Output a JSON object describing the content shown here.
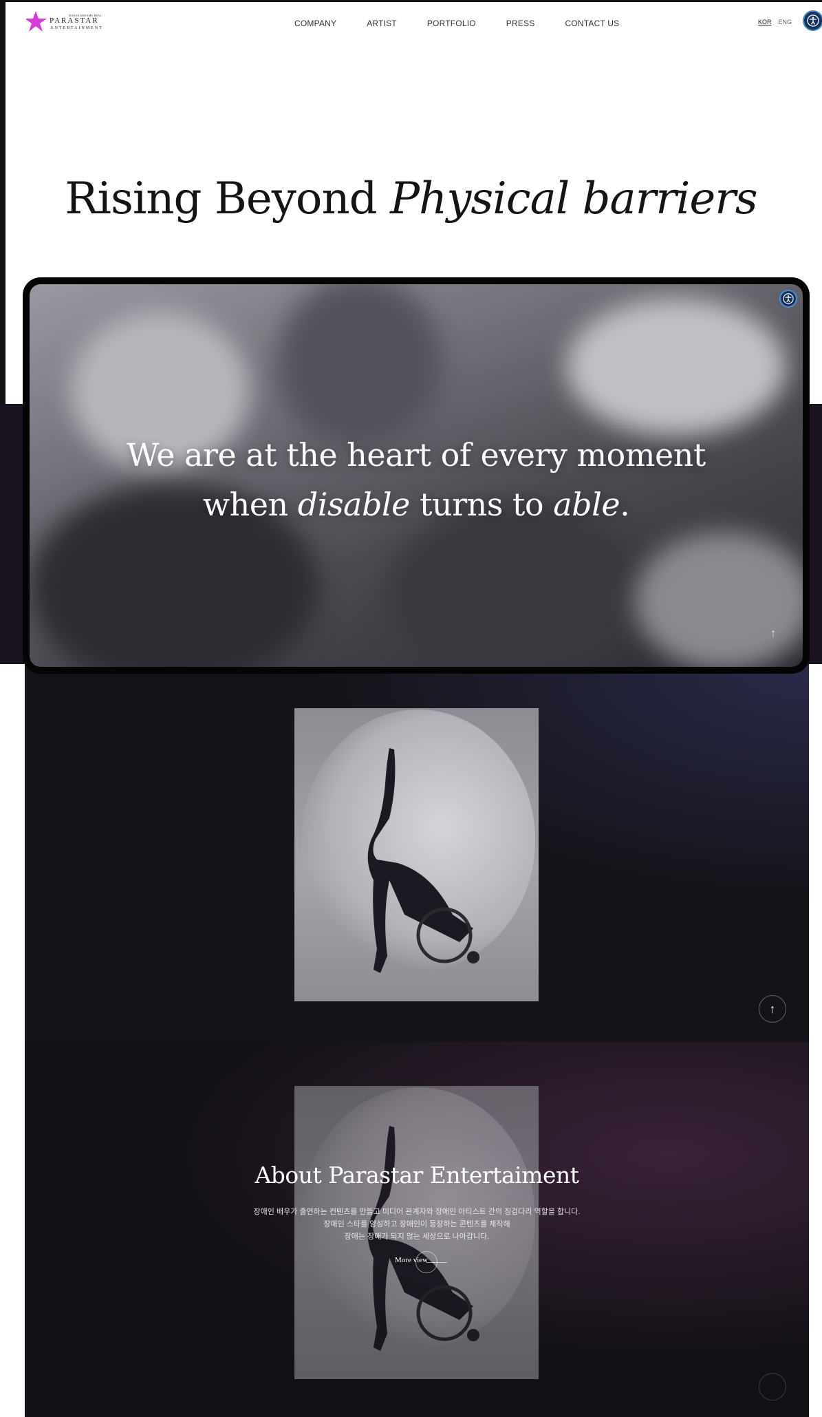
{
  "header": {
    "logo": {
      "tagline": "MAKES DREAMS REAL",
      "name": "PARASTAR",
      "sub": "ENTERTAINMENT"
    },
    "nav": [
      "COMPANY",
      "ARTIST",
      "PORTFOLIO",
      "PRESS",
      "CONTACT US"
    ],
    "lang": {
      "kor": "KOR",
      "eng": "ENG"
    },
    "accessibility_icon": "accessibility-icon"
  },
  "hero": {
    "title_plain": "Rising Beyond ",
    "title_italic": "Physical barriers"
  },
  "video": {
    "line1": "We are at the heart of every moment",
    "line2_a": "when ",
    "line2_b": "disable",
    "line2_c": " turns to ",
    "line2_d": "able",
    "line2_e": ".",
    "up_icon": "arrow-up-icon"
  },
  "about": {
    "title": "About Parastar Entertaiment",
    "desc_lines": [
      "장애인 배우가 출연하는 컨텐츠를 만들고 미디어 관계자와 장애인 아티스트 간의 징검다리 역할을 합니다.",
      "장애인 스타를 양성하고 장애인이 등장하는 콘텐츠를 제작해",
      "장애는 장애가 되지 않는 세상으로 나아갑니다."
    ],
    "more_view": "More view"
  },
  "colors": {
    "accent_blue": "#16325c",
    "logo_pink": "#d63ad9",
    "dark_bg": "#121116"
  }
}
